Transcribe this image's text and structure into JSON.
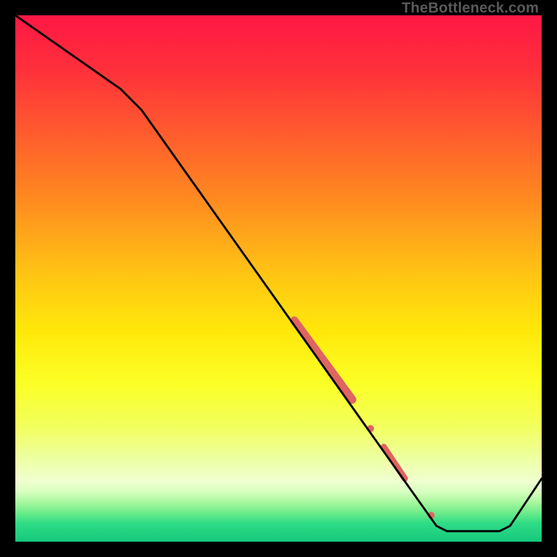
{
  "watermark": "TheBottleneck.com",
  "colors": {
    "black": "#000000",
    "curve": "#000000",
    "marker": "#e0645f",
    "gradient_stops": [
      {
        "offset": 0.0,
        "color": "#ff1745"
      },
      {
        "offset": 0.1,
        "color": "#ff2f3b"
      },
      {
        "offset": 0.22,
        "color": "#ff5a2e"
      },
      {
        "offset": 0.35,
        "color": "#ff8a20"
      },
      {
        "offset": 0.48,
        "color": "#ffc015"
      },
      {
        "offset": 0.6,
        "color": "#ffe80a"
      },
      {
        "offset": 0.7,
        "color": "#fbff26"
      },
      {
        "offset": 0.78,
        "color": "#f3ff5c"
      },
      {
        "offset": 0.84,
        "color": "#edffa0"
      },
      {
        "offset": 0.885,
        "color": "#f0ffd0"
      },
      {
        "offset": 0.905,
        "color": "#d8ffc0"
      },
      {
        "offset": 0.925,
        "color": "#a8f8a0"
      },
      {
        "offset": 0.945,
        "color": "#6deb8a"
      },
      {
        "offset": 0.965,
        "color": "#2fdc86"
      },
      {
        "offset": 1.0,
        "color": "#14c87c"
      }
    ]
  },
  "chart_data": {
    "type": "line",
    "title": "",
    "xlabel": "",
    "ylabel": "",
    "xlim": [
      0,
      100
    ],
    "ylim": [
      0,
      100
    ],
    "series": [
      {
        "name": "curve",
        "points": [
          {
            "x": 0,
            "y": 100
          },
          {
            "x": 20,
            "y": 86
          },
          {
            "x": 24,
            "y": 82
          },
          {
            "x": 80,
            "y": 3
          },
          {
            "x": 82,
            "y": 2
          },
          {
            "x": 92,
            "y": 2
          },
          {
            "x": 94,
            "y": 3
          },
          {
            "x": 100,
            "y": 12
          }
        ]
      }
    ],
    "highlights": [
      {
        "name": "thick-segment",
        "x0": 53,
        "y0": 42,
        "x1": 64,
        "y1": 27,
        "width": 12
      },
      {
        "name": "dot-a",
        "x": 67.5,
        "y": 21.5,
        "r": 5
      },
      {
        "name": "short-segment",
        "x0": 70,
        "y0": 18,
        "x1": 74,
        "y1": 12,
        "width": 9
      },
      {
        "name": "dot-b",
        "x": 79,
        "y": 5,
        "r": 5
      }
    ]
  }
}
